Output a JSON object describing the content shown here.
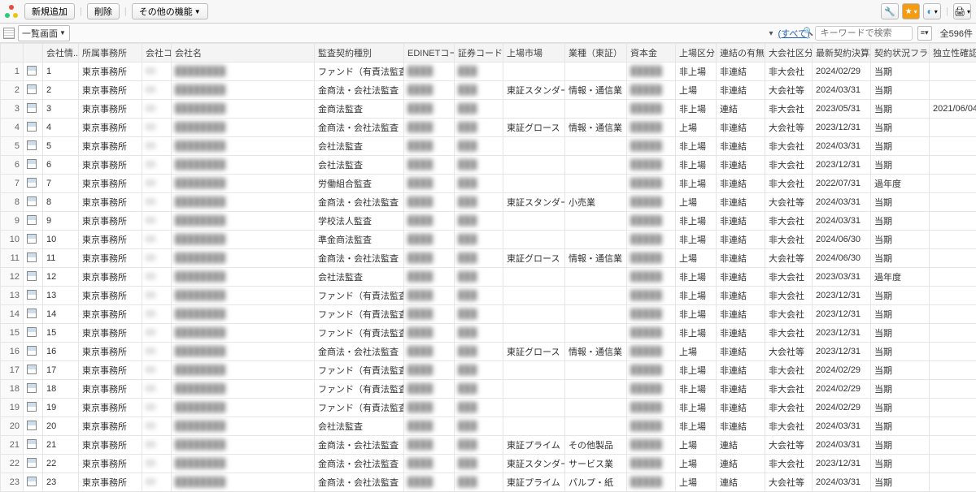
{
  "toolbar": {
    "add": "新規追加",
    "delete": "削除",
    "other": "その他の機能"
  },
  "subbar": {
    "view": "一覧画面",
    "all": "(すべて)",
    "search_placeholder": "キーワードで検索",
    "count": "全596件"
  },
  "columns": {
    "num": "",
    "icon": "",
    "info": "会社情...",
    "office": "所属事務所",
    "code": "会社コ...",
    "name": "会社名",
    "audit": "監査契約種別",
    "edinet": "EDINETコード",
    "sec": "証券コード",
    "market": "上場市場",
    "industry": "業種（東証）",
    "capital": "資本金",
    "listing": "上場区分",
    "consolidated": "連結の有無",
    "large": "大会社区分",
    "close": "最新契約決算期",
    "status": "契約状況フラグ",
    "indep": "独立性確認日"
  },
  "rows": [
    {
      "n": 1,
      "info": "1",
      "office": "東京事務所",
      "audit": "ファンド（有責法監査）",
      "market": "",
      "ind": "",
      "listing": "非上場",
      "cons": "非連結",
      "large": "非大会社",
      "close": "2024/02/29",
      "status": "当期",
      "indep": ""
    },
    {
      "n": 2,
      "info": "2",
      "office": "東京事務所",
      "audit": "金商法・会社法監査",
      "market": "東証スタンダード",
      "ind": "情報・通信業",
      "listing": "上場",
      "cons": "非連結",
      "large": "大会社等",
      "close": "2024/03/31",
      "status": "当期",
      "indep": ""
    },
    {
      "n": 3,
      "info": "3",
      "office": "東京事務所",
      "audit": "金商法監査",
      "market": "",
      "ind": "",
      "listing": "非上場",
      "cons": "連結",
      "large": "非大会社",
      "close": "2023/05/31",
      "status": "当期",
      "indep": "2021/06/04"
    },
    {
      "n": 4,
      "info": "4",
      "office": "東京事務所",
      "audit": "金商法・会社法監査",
      "market": "東証グロース",
      "ind": "情報・通信業",
      "listing": "上場",
      "cons": "非連結",
      "large": "大会社等",
      "close": "2023/12/31",
      "status": "当期",
      "indep": ""
    },
    {
      "n": 5,
      "info": "5",
      "office": "東京事務所",
      "audit": "会社法監査",
      "market": "",
      "ind": "",
      "listing": "非上場",
      "cons": "非連結",
      "large": "非大会社",
      "close": "2024/03/31",
      "status": "当期",
      "indep": ""
    },
    {
      "n": 6,
      "info": "6",
      "office": "東京事務所",
      "audit": "会社法監査",
      "market": "",
      "ind": "",
      "listing": "非上場",
      "cons": "非連結",
      "large": "非大会社",
      "close": "2023/12/31",
      "status": "当期",
      "indep": ""
    },
    {
      "n": 7,
      "info": "7",
      "office": "東京事務所",
      "audit": "労働組合監査",
      "market": "",
      "ind": "",
      "listing": "非上場",
      "cons": "非連結",
      "large": "非大会社",
      "close": "2022/07/31",
      "status": "過年度",
      "indep": ""
    },
    {
      "n": 8,
      "info": "8",
      "office": "東京事務所",
      "audit": "金商法・会社法監査",
      "market": "東証スタンダード",
      "ind": "小売業",
      "listing": "上場",
      "cons": "非連結",
      "large": "大会社等",
      "close": "2024/03/31",
      "status": "当期",
      "indep": ""
    },
    {
      "n": 9,
      "info": "9",
      "office": "東京事務所",
      "audit": "学校法人監査",
      "market": "",
      "ind": "",
      "listing": "非上場",
      "cons": "非連結",
      "large": "非大会社",
      "close": "2024/03/31",
      "status": "当期",
      "indep": ""
    },
    {
      "n": 10,
      "info": "10",
      "office": "東京事務所",
      "audit": "準金商法監査",
      "market": "",
      "ind": "",
      "listing": "非上場",
      "cons": "非連結",
      "large": "非大会社",
      "close": "2024/06/30",
      "status": "当期",
      "indep": ""
    },
    {
      "n": 11,
      "info": "11",
      "office": "東京事務所",
      "audit": "金商法・会社法監査",
      "market": "東証グロース",
      "ind": "情報・通信業",
      "listing": "上場",
      "cons": "非連結",
      "large": "大会社等",
      "close": "2024/06/30",
      "status": "当期",
      "indep": ""
    },
    {
      "n": 12,
      "info": "12",
      "office": "東京事務所",
      "audit": "会社法監査",
      "market": "",
      "ind": "",
      "listing": "非上場",
      "cons": "非連結",
      "large": "非大会社",
      "close": "2023/03/31",
      "status": "過年度",
      "indep": ""
    },
    {
      "n": 13,
      "info": "13",
      "office": "東京事務所",
      "audit": "ファンド（有責法監査）",
      "market": "",
      "ind": "",
      "listing": "非上場",
      "cons": "非連結",
      "large": "非大会社",
      "close": "2023/12/31",
      "status": "当期",
      "indep": ""
    },
    {
      "n": 14,
      "info": "14",
      "office": "東京事務所",
      "audit": "ファンド（有責法監査）",
      "market": "",
      "ind": "",
      "listing": "非上場",
      "cons": "非連結",
      "large": "非大会社",
      "close": "2023/12/31",
      "status": "当期",
      "indep": ""
    },
    {
      "n": 15,
      "info": "15",
      "office": "東京事務所",
      "audit": "ファンド（有責法監査）",
      "market": "",
      "ind": "",
      "listing": "非上場",
      "cons": "非連結",
      "large": "非大会社",
      "close": "2023/12/31",
      "status": "当期",
      "indep": ""
    },
    {
      "n": 16,
      "info": "16",
      "office": "東京事務所",
      "audit": "金商法・会社法監査",
      "market": "東証グロース",
      "ind": "情報・通信業",
      "listing": "上場",
      "cons": "非連結",
      "large": "大会社等",
      "close": "2023/12/31",
      "status": "当期",
      "indep": ""
    },
    {
      "n": 17,
      "info": "17",
      "office": "東京事務所",
      "audit": "ファンド（有責法監査）",
      "market": "",
      "ind": "",
      "listing": "非上場",
      "cons": "非連結",
      "large": "非大会社",
      "close": "2024/02/29",
      "status": "当期",
      "indep": ""
    },
    {
      "n": 18,
      "info": "18",
      "office": "東京事務所",
      "audit": "ファンド（有責法監査）",
      "market": "",
      "ind": "",
      "listing": "非上場",
      "cons": "非連結",
      "large": "非大会社",
      "close": "2024/02/29",
      "status": "当期",
      "indep": ""
    },
    {
      "n": 19,
      "info": "19",
      "office": "東京事務所",
      "audit": "ファンド（有責法監査）",
      "market": "",
      "ind": "",
      "listing": "非上場",
      "cons": "非連結",
      "large": "非大会社",
      "close": "2024/02/29",
      "status": "当期",
      "indep": ""
    },
    {
      "n": 20,
      "info": "20",
      "office": "東京事務所",
      "audit": "会社法監査",
      "market": "",
      "ind": "",
      "listing": "非上場",
      "cons": "非連結",
      "large": "非大会社",
      "close": "2024/03/31",
      "status": "当期",
      "indep": ""
    },
    {
      "n": 21,
      "info": "21",
      "office": "東京事務所",
      "audit": "金商法・会社法監査",
      "market": "東証プライム",
      "ind": "その他製品",
      "listing": "上場",
      "cons": "連結",
      "large": "大会社等",
      "close": "2024/03/31",
      "status": "当期",
      "indep": ""
    },
    {
      "n": 22,
      "info": "22",
      "office": "東京事務所",
      "audit": "金商法・会社法監査",
      "market": "東証スタンダード",
      "ind": "サービス業",
      "listing": "上場",
      "cons": "連結",
      "large": "非大会社",
      "close": "2023/12/31",
      "status": "当期",
      "indep": ""
    },
    {
      "n": 23,
      "info": "23",
      "office": "東京事務所",
      "audit": "金商法・会社法監査",
      "market": "東証プライム",
      "ind": "パルプ・紙",
      "listing": "上場",
      "cons": "連結",
      "large": "大会社等",
      "close": "2024/03/31",
      "status": "当期",
      "indep": ""
    }
  ],
  "blur": {
    "code": "00",
    "name": "████████",
    "edinet": "████",
    "sec": "███",
    "capital": "█████"
  }
}
